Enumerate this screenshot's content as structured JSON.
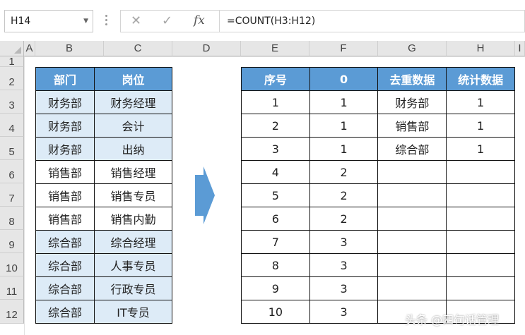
{
  "formula_bar": {
    "name_box": "H14",
    "cancel_glyph": "✕",
    "enter_glyph": "✓",
    "fx_label": "fx",
    "formula": "=COUNT(H3:H12)"
  },
  "columns": [
    "A",
    "B",
    "C",
    "D",
    "E",
    "F",
    "G",
    "H",
    "I"
  ],
  "rows": [
    "1",
    "2",
    "3",
    "4",
    "5",
    "6",
    "7",
    "8",
    "9",
    "10",
    "11",
    "12"
  ],
  "left_table": {
    "headers": [
      "部门",
      "岗位"
    ],
    "rows": [
      [
        "财务部",
        "财务经理"
      ],
      [
        "财务部",
        "会计"
      ],
      [
        "财务部",
        "出纳"
      ],
      [
        "销售部",
        "销售经理"
      ],
      [
        "销售部",
        "销售专员"
      ],
      [
        "销售部",
        "销售内勤"
      ],
      [
        "综合部",
        "综合经理"
      ],
      [
        "综合部",
        "人事专员"
      ],
      [
        "综合部",
        "行政专员"
      ],
      [
        "综合部",
        "IT专员"
      ]
    ]
  },
  "right_table": {
    "headers": [
      "序号",
      "0",
      "去重数据",
      "统计数据"
    ],
    "rows": [
      [
        "1",
        "1",
        "财务部",
        "1"
      ],
      [
        "2",
        "1",
        "销售部",
        "1"
      ],
      [
        "3",
        "1",
        "综合部",
        "1"
      ],
      [
        "4",
        "2",
        "",
        ""
      ],
      [
        "5",
        "2",
        "",
        ""
      ],
      [
        "6",
        "2",
        "",
        ""
      ],
      [
        "7",
        "3",
        "",
        ""
      ],
      [
        "8",
        "3",
        "",
        ""
      ],
      [
        "9",
        "3",
        "",
        ""
      ],
      [
        "10",
        "3",
        "",
        ""
      ]
    ]
  },
  "watermark": "头条 @四句话管理",
  "colors": {
    "header_blue": "#5b9bd5",
    "light_blue": "#ddebf7",
    "arrow_blue": "#5b9bd5"
  }
}
